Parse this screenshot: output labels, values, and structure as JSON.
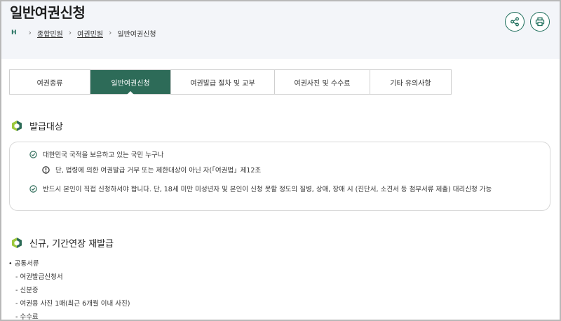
{
  "header": {
    "title": "일반여권신청",
    "breadcrumb": {
      "home_icon": "H",
      "items": [
        "종합민원",
        "여권민원",
        "일반여권신청"
      ]
    },
    "share_icon": "share-icon",
    "print_icon": "print-icon"
  },
  "tabs": [
    {
      "label": "여권종류"
    },
    {
      "label": "일반여권신청"
    },
    {
      "label": "여권발급 절차 및 교부"
    },
    {
      "label": "여권사진 및 수수료"
    },
    {
      "label": "기타 유의사항"
    }
  ],
  "active_tab": "일반여권신청",
  "colors": {
    "accent": "#2d6b58",
    "hex_light": "#9cc83c",
    "hex_dark": "#2d6b58"
  },
  "section1": {
    "title": "발급대상",
    "items": [
      "대한민국 국적을 보유하고 있는 국민 누구나",
      "단, 법령에 의한 여권발급 거부 또는 제한대상이 아닌 자(「여권법」제12조",
      "반드시 본인이 직접 신청하셔야 합니다. 단, 18세 미만 미성년자 및 본인이 신청 못할 정도의 질병, 상애, 장애 시 (진단서, 소견서 등 첨부서류 제출) 대리신청 가능"
    ]
  },
  "section2": {
    "title": "신규, 기간연장 재발급",
    "list_title": "공통서류",
    "sub_items": [
      "여권발급신청서",
      "신분증",
      "여권용 사진 1매(최근 6개월 이내 사진)",
      "수수료"
    ]
  }
}
